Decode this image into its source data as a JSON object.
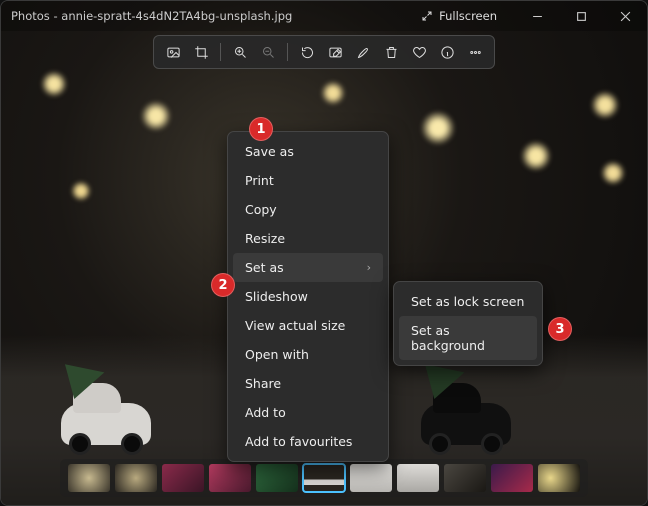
{
  "titlebar": {
    "app_prefix": "Photos",
    "filename": "annie-spratt-4s4dN2TA4bg-unsplash.jpg",
    "fullscreen_label": "Fullscreen"
  },
  "toolbar": {
    "icons": [
      "image-icon",
      "crop-icon",
      "zoom-in-icon",
      "zoom-out-icon",
      "rotate-icon",
      "edit-image-icon",
      "markup-icon",
      "delete-icon",
      "favourite-icon",
      "info-icon",
      "more-icon"
    ]
  },
  "context_menu": {
    "items": [
      {
        "label": "Save as",
        "submenu": false
      },
      {
        "label": "Print",
        "submenu": false
      },
      {
        "label": "Copy",
        "submenu": false
      },
      {
        "label": "Resize",
        "submenu": false
      },
      {
        "label": "Set as",
        "submenu": true,
        "hover": true
      },
      {
        "label": "Slideshow",
        "submenu": false
      },
      {
        "label": "View actual size",
        "submenu": false
      },
      {
        "label": "Open with",
        "submenu": false
      },
      {
        "label": "Share",
        "submenu": false
      },
      {
        "label": "Add to",
        "submenu": false
      },
      {
        "label": "Add to favourites",
        "submenu": false
      }
    ]
  },
  "submenu": {
    "items": [
      {
        "label": "Set as lock screen",
        "hover": false
      },
      {
        "label": "Set as background",
        "hover": true
      }
    ]
  },
  "callouts": {
    "one": "1",
    "two": "2",
    "three": "3"
  },
  "filmstrip": {
    "count": 11,
    "selected_index": 5
  }
}
